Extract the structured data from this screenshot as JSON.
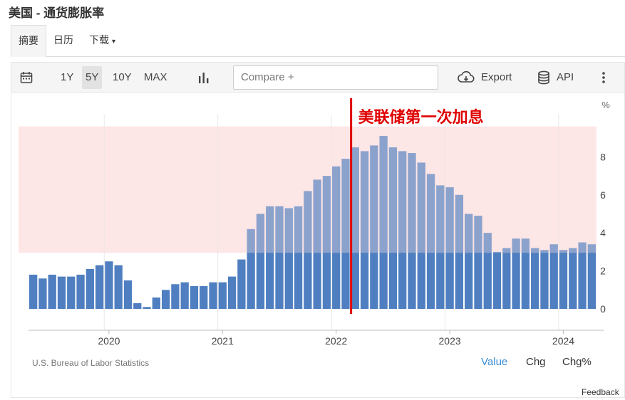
{
  "page": {
    "title": "美国 - 通货膨胀率"
  },
  "tabs": [
    {
      "label": "摘要",
      "active": true
    },
    {
      "label": "日历",
      "active": false
    },
    {
      "label": "下载",
      "active": false,
      "caret": "▾"
    }
  ],
  "toolbar": {
    "ranges": [
      "1Y",
      "5Y",
      "10Y",
      "MAX"
    ],
    "active_range": "5Y",
    "compare_placeholder": "Compare +",
    "export_label": "Export",
    "api_label": "API",
    "icons": [
      "calendar-icon",
      "bar-chart-icon",
      "cloud-download-icon",
      "database-icon",
      "more-vertical-icon"
    ]
  },
  "chart_data": {
    "type": "bar",
    "unit": "%",
    "annotation": "美联储第一次加息",
    "bar_color": "#4f7fc0",
    "highlight_color": "#fde6e6",
    "annotation_color": "#e00000",
    "x_tick_labels": [
      "2020",
      "2021",
      "2022",
      "2023",
      "2024"
    ],
    "y_tick_labels": [
      "0",
      "2",
      "4",
      "6",
      "8"
    ],
    "ylim": [
      -0.2,
      9.6
    ],
    "highlight_band": [
      2.95,
      9.6
    ],
    "categories": [
      "2019-05",
      "2019-06",
      "2019-07",
      "2019-08",
      "2019-09",
      "2019-10",
      "2019-11",
      "2019-12",
      "2020-01",
      "2020-02",
      "2020-03",
      "2020-04",
      "2020-05",
      "2020-06",
      "2020-07",
      "2020-08",
      "2020-09",
      "2020-10",
      "2020-11",
      "2020-12",
      "2021-01",
      "2021-02",
      "2021-03",
      "2021-04",
      "2021-05",
      "2021-06",
      "2021-07",
      "2021-08",
      "2021-09",
      "2021-10",
      "2021-11",
      "2021-12",
      "2022-01",
      "2022-02",
      "2022-03",
      "2022-04",
      "2022-05",
      "2022-06",
      "2022-07",
      "2022-08",
      "2022-09",
      "2022-10",
      "2022-11",
      "2022-12",
      "2023-01",
      "2023-02",
      "2023-03",
      "2023-04",
      "2023-05",
      "2023-06",
      "2023-07",
      "2023-08",
      "2023-09",
      "2023-10",
      "2023-11",
      "2023-12",
      "2024-01",
      "2024-02",
      "2024-03",
      "2024-04"
    ],
    "values": [
      1.8,
      1.6,
      1.8,
      1.7,
      1.7,
      1.8,
      2.1,
      2.3,
      2.5,
      2.3,
      1.5,
      0.3,
      0.1,
      0.6,
      1.0,
      1.3,
      1.4,
      1.2,
      1.2,
      1.4,
      1.4,
      1.7,
      2.6,
      4.2,
      5.0,
      5.4,
      5.4,
      5.3,
      5.4,
      6.2,
      6.8,
      7.0,
      7.5,
      7.9,
      8.5,
      8.3,
      8.6,
      9.1,
      8.5,
      8.3,
      8.2,
      7.7,
      7.1,
      6.5,
      6.4,
      6.0,
      5.0,
      4.9,
      4.0,
      3.0,
      3.2,
      3.7,
      3.7,
      3.2,
      3.1,
      3.4,
      3.1,
      3.2,
      3.5,
      3.4
    ],
    "rate_hike_month": "2022-03"
  },
  "footer": {
    "source": "U.S. Bureau of Labor Statistics",
    "views": [
      "Value",
      "Chg",
      "Chg%"
    ],
    "active_view": "Value",
    "feedback": "Feedback"
  }
}
